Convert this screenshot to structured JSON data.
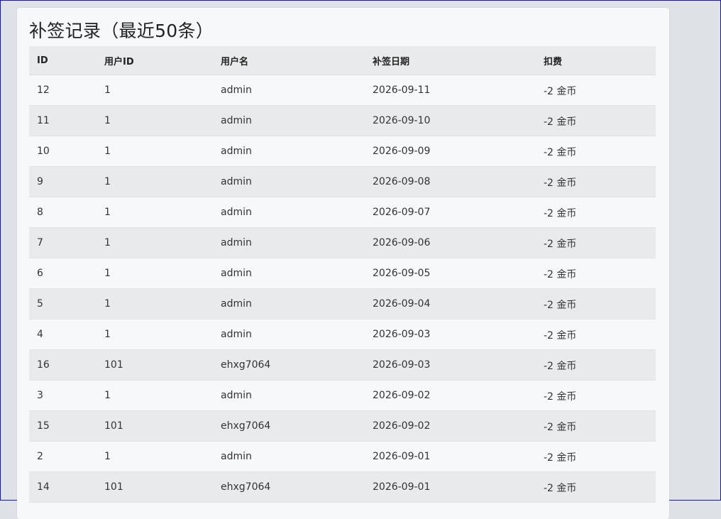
{
  "page": {
    "title": "补签记录（最近50条）"
  },
  "table": {
    "headers": [
      "ID",
      "用户ID",
      "用户名",
      "补签日期",
      "扣费"
    ],
    "rows": [
      [
        "12",
        "1",
        "admin",
        "2026-09-11",
        "-2 金币"
      ],
      [
        "11",
        "1",
        "admin",
        "2026-09-10",
        "-2 金币"
      ],
      [
        "10",
        "1",
        "admin",
        "2026-09-09",
        "-2 金币"
      ],
      [
        "9",
        "1",
        "admin",
        "2026-09-08",
        "-2 金币"
      ],
      [
        "8",
        "1",
        "admin",
        "2026-09-07",
        "-2 金币"
      ],
      [
        "7",
        "1",
        "admin",
        "2026-09-06",
        "-2 金币"
      ],
      [
        "6",
        "1",
        "admin",
        "2026-09-05",
        "-2 金币"
      ],
      [
        "5",
        "1",
        "admin",
        "2026-09-04",
        "-2 金币"
      ],
      [
        "4",
        "1",
        "admin",
        "2026-09-03",
        "-2 金币"
      ],
      [
        "16",
        "101",
        "ehxg7064",
        "2026-09-03",
        "-2 金币"
      ],
      [
        "3",
        "1",
        "admin",
        "2026-09-02",
        "-2 金币"
      ],
      [
        "15",
        "101",
        "ehxg7064",
        "2026-09-02",
        "-2 金币"
      ],
      [
        "2",
        "1",
        "admin",
        "2026-09-01",
        "-2 金币"
      ],
      [
        "14",
        "101",
        "ehxg7064",
        "2026-09-01",
        "-2 金币"
      ]
    ]
  },
  "colors": {
    "page_background": "#dee1e6",
    "card_background": "#f7f8fa",
    "row_stripe": "#e9eaec",
    "window_border": "#1a14c8"
  }
}
